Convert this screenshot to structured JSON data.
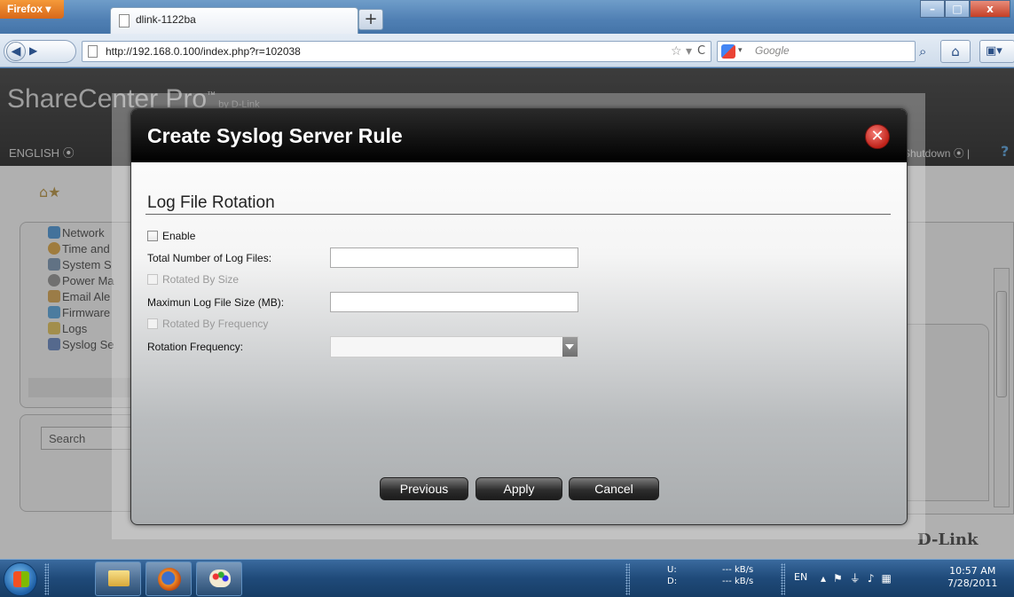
{
  "browser": {
    "menu_label": "Firefox",
    "tab_title": "dlink-1122ba",
    "new_tab": "+",
    "url": "http://192.168.0.100/index.php?r=102038",
    "search_placeholder": "Google",
    "window_controls": {
      "minimize": "–",
      "maximize": "□",
      "close": "x"
    }
  },
  "page": {
    "brand": "ShareCenter Pro",
    "brand_tm": "™",
    "brand_by": "by D-Link",
    "language": "ENGLISH",
    "shutdown": "Shutdown",
    "help": "?",
    "sidebar": {
      "items": [
        {
          "label": "Network",
          "color": "#3a8fd9"
        },
        {
          "label": "Time and",
          "color": "#e0a030"
        },
        {
          "label": "System S",
          "color": "#6f8fb0"
        },
        {
          "label": "Power Ma",
          "color": "#8a8a8a"
        },
        {
          "label": "Email Ale",
          "color": "#d9a040"
        },
        {
          "label": "Firmware",
          "color": "#4aa0e0"
        },
        {
          "label": "Logs",
          "color": "#e6c24a"
        },
        {
          "label": "Syslog Se",
          "color": "#5a7fc0"
        }
      ],
      "search_label": "Search"
    },
    "footer_logo": "D-Link"
  },
  "dialog": {
    "title": "Create Syslog Server Rule",
    "section_title": "Log File Rotation",
    "enable_label": "Enable",
    "total_files_label": "Total Number of Log Files:",
    "total_files_value": "",
    "rotated_by_size_label": "Rotated By Size",
    "max_size_label": "Maximun Log File Size (MB):",
    "max_size_value": "",
    "rotated_by_freq_label": "Rotated By Frequency",
    "rotation_freq_label": "Rotation Frequency:",
    "rotation_freq_value": "",
    "buttons": {
      "previous": "Previous",
      "apply": "Apply",
      "cancel": "Cancel"
    }
  },
  "taskbar": {
    "net_labels": "U:\nD:",
    "net_values": "--- kB/s\n--- kB/s",
    "language": "EN",
    "time": "10:57 AM",
    "date": "7/28/2011"
  },
  "colors": {
    "dialog_header": "#000000",
    "close_button": "#c0231a",
    "taskbar": "#1f4a79"
  }
}
